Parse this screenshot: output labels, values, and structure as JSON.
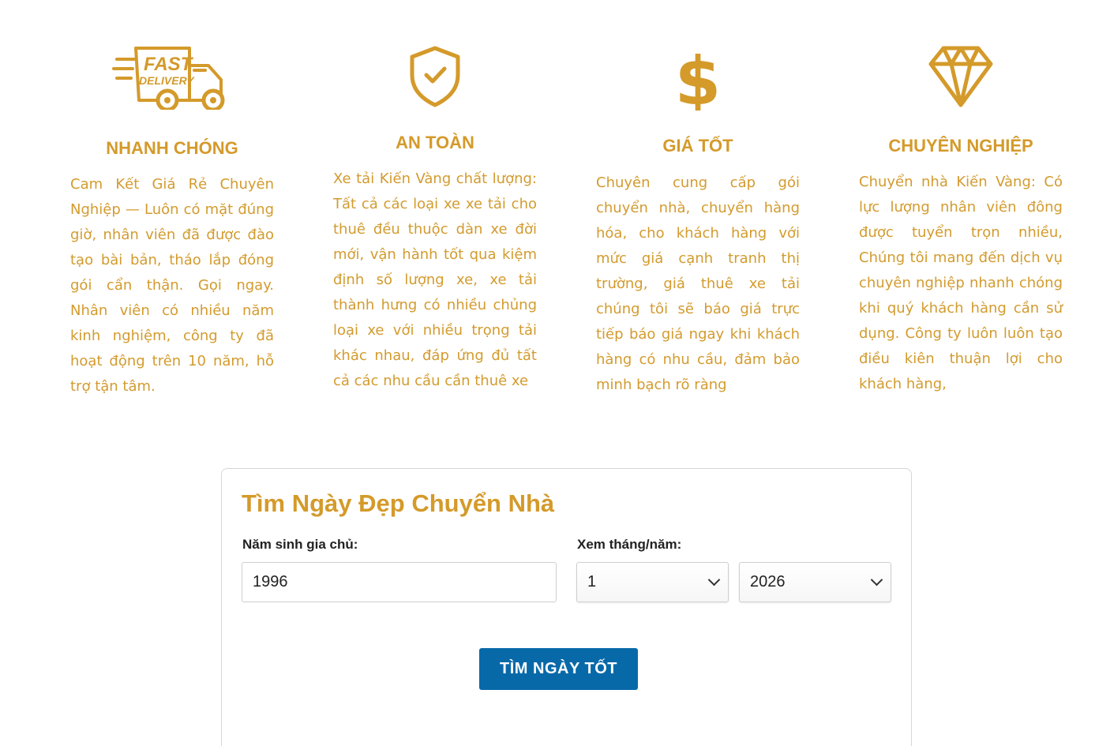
{
  "colors": {
    "accent": "#d49a2a",
    "button": "#0869a9"
  },
  "features": [
    {
      "icon": "fast-delivery-truck-icon",
      "icon_text_line1": "FAST",
      "icon_text_line2": "DELIVERY",
      "title": "NHANH CHÓNG",
      "text": "Cam Kết Giá Rẻ Chuyên Nghiệp — Luôn có mặt đúng giờ, nhân viên đã được đào tạo bài bản, tháo lắp đóng gói cẩn thận. Gọi ngay. Nhân viên có nhiều năm kinh nghiệm, công ty đã hoạt động trên 10 năm, hỗ trợ tận tâm."
    },
    {
      "icon": "shield-check-icon",
      "title": "AN TOÀN",
      "text": "Xe tải Kiến Vàng chất lượng: Tất cả các loại xe xe tải cho thuê đều thuộc dàn xe đời mới, vận hành tốt qua kiệm định số lượng xe, xe tải thành hưng có nhiều chủng loại xe với nhiều trọng tải khác nhau, đáp ứng đủ tất cả các nhu cầu cần thuê xe"
    },
    {
      "icon": "dollar-sign-icon",
      "title": "GIÁ TỐT",
      "text": "Chuyên cung cấp gói chuyển nhà, chuyển hàng hóa, cho khách hàng với mức giá cạnh tranh thị trường, giá thuê xe tải chúng tôi sẽ báo giá trực tiếp báo giá ngay khi khách hàng có nhu cầu, đảm bảo minh bạch rõ ràng"
    },
    {
      "icon": "diamond-icon",
      "title": "CHUYÊN NGHIỆP",
      "text": "Chuyển nhà Kiến Vàng: Có lực lượng nhân viên đông được tuyển trọn nhiều, Chúng tôi mang đến dịch vụ chuyên nghiệp nhanh chóng khi quý khách hàng cần sử dụng. Công ty luôn luôn tạo điều kiên thuận lợi cho khách hàng,"
    }
  ],
  "form": {
    "title": "Tìm Ngày Đẹp Chuyển Nhà",
    "birth_year_label": "Năm sinh gia chủ:",
    "birth_year_value": "1996",
    "month_year_label": "Xem tháng/năm:",
    "month_value": "1",
    "year_value": "2026",
    "submit_label": "TÌM NGÀY TỐT"
  }
}
